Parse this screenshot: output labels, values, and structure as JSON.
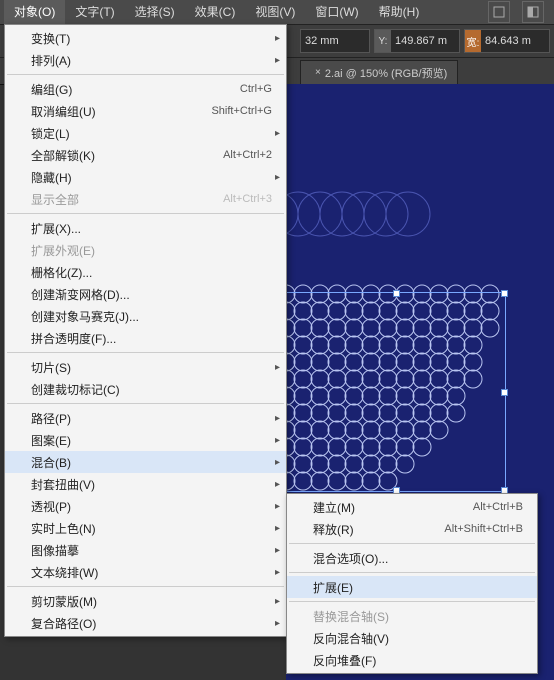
{
  "menubar": {
    "items": [
      "对象(O)",
      "文字(T)",
      "选择(S)",
      "效果(C)",
      "视图(V)",
      "窗口(W)",
      "帮助(H)"
    ],
    "active_index": 0
  },
  "options": {
    "fields": [
      {
        "label": "",
        "value": "32 mm"
      },
      {
        "label": "Y:",
        "value": "149.867 m"
      },
      {
        "label": "宽:",
        "value": "84.643 m"
      }
    ]
  },
  "tab": {
    "close": "×",
    "label": "2.ai @ 150% (RGB/预览)"
  },
  "object_menu": [
    {
      "t": "item",
      "label": "变换(T)",
      "sub": true
    },
    {
      "t": "item",
      "label": "排列(A)",
      "sub": true
    },
    {
      "t": "sep"
    },
    {
      "t": "item",
      "label": "编组(G)",
      "shortcut": "Ctrl+G"
    },
    {
      "t": "item",
      "label": "取消编组(U)",
      "shortcut": "Shift+Ctrl+G"
    },
    {
      "t": "item",
      "label": "锁定(L)",
      "sub": true
    },
    {
      "t": "item",
      "label": "全部解锁(K)",
      "shortcut": "Alt+Ctrl+2"
    },
    {
      "t": "item",
      "label": "隐藏(H)",
      "sub": true
    },
    {
      "t": "item",
      "label": "显示全部",
      "shortcut": "Alt+Ctrl+3",
      "dis": true
    },
    {
      "t": "sep"
    },
    {
      "t": "item",
      "label": "扩展(X)..."
    },
    {
      "t": "item",
      "label": "扩展外观(E)",
      "dis": true
    },
    {
      "t": "item",
      "label": "栅格化(Z)..."
    },
    {
      "t": "item",
      "label": "创建渐变网格(D)..."
    },
    {
      "t": "item",
      "label": "创建对象马赛克(J)..."
    },
    {
      "t": "item",
      "label": "拼合透明度(F)..."
    },
    {
      "t": "sep"
    },
    {
      "t": "item",
      "label": "切片(S)",
      "sub": true
    },
    {
      "t": "item",
      "label": "创建裁切标记(C)"
    },
    {
      "t": "sep"
    },
    {
      "t": "item",
      "label": "路径(P)",
      "sub": true
    },
    {
      "t": "item",
      "label": "图案(E)",
      "sub": true
    },
    {
      "t": "item",
      "label": "混合(B)",
      "sub": true,
      "hl": true
    },
    {
      "t": "item",
      "label": "封套扭曲(V)",
      "sub": true
    },
    {
      "t": "item",
      "label": "透视(P)",
      "sub": true
    },
    {
      "t": "item",
      "label": "实时上色(N)",
      "sub": true
    },
    {
      "t": "item",
      "label": "图像描摹",
      "sub": true
    },
    {
      "t": "item",
      "label": "文本绕排(W)",
      "sub": true
    },
    {
      "t": "sep"
    },
    {
      "t": "item",
      "label": "剪切蒙版(M)",
      "sub": true
    },
    {
      "t": "item",
      "label": "复合路径(O)",
      "sub": true
    }
  ],
  "blend_submenu": [
    {
      "t": "item",
      "label": "建立(M)",
      "shortcut": "Alt+Ctrl+B"
    },
    {
      "t": "item",
      "label": "释放(R)",
      "shortcut": "Alt+Shift+Ctrl+B"
    },
    {
      "t": "sep"
    },
    {
      "t": "item",
      "label": "混合选项(O)..."
    },
    {
      "t": "sep"
    },
    {
      "t": "item",
      "label": "扩展(E)",
      "hl": true
    },
    {
      "t": "sep"
    },
    {
      "t": "item",
      "label": "替换混合轴(S)",
      "dis": true
    },
    {
      "t": "item",
      "label": "反向混合轴(V)"
    },
    {
      "t": "item",
      "label": "反向堆叠(F)"
    }
  ]
}
